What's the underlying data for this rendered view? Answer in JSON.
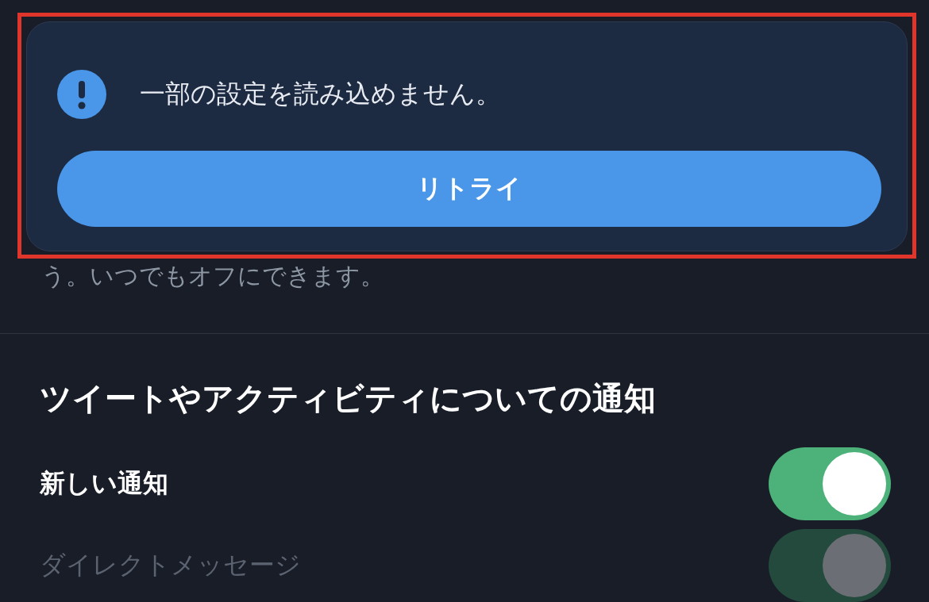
{
  "alert": {
    "message": "一部の設定を読み込めません。",
    "button": "リトライ"
  },
  "description_tail": "う。いつでもオフにできます。",
  "section": {
    "title": "ツイートやアクティビティについての通知",
    "settings": [
      {
        "label": "新しい通知",
        "on": true,
        "disabled": false
      },
      {
        "label": "ダイレクトメッセージ",
        "on": true,
        "disabled": true
      }
    ]
  }
}
